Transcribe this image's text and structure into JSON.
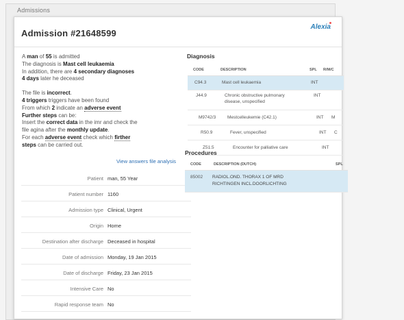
{
  "window": {
    "title": "Admissions"
  },
  "header": {
    "title": "Admission #21648599",
    "logo": "Alexia"
  },
  "summary": {
    "s1a": "A ",
    "s1b": "man",
    "s1c": " of ",
    "s1d": "55",
    "s1e": " is admitted",
    "s2a": "The diagnosis is ",
    "s2b": "Mast cell leukaemia",
    "s3a": "In addition, there are ",
    "s3b": "4 secondary diagnoses",
    "s4a": "4 days",
    "s4b": " later he deceased",
    "s5a": "The file is ",
    "s5b": "incorrect",
    "s5c": ".",
    "s6a": "4 triggers",
    "s6b": " triggers have been found",
    "s7a": "From which ",
    "s7b": "2",
    "s7c": " indicate an ",
    "s7d": "adverse event",
    "s8a": "Further steps",
    "s8b": " can be:",
    "s9a": "Insert the ",
    "s9b": "correct data",
    "s9c": " in the imr and check the",
    "s10a": "file agina after the ",
    "s10b": "monthly update",
    "s10c": ".",
    "s11a": "For each ",
    "s11b": "adverse event",
    "s11c": " check which ",
    "s11d": "firther",
    "s12a": "steps",
    "s12b": " can be carried out."
  },
  "view_link": "View answers file analysis",
  "details": [
    {
      "label": "Patient",
      "value": "man, 55 Year"
    },
    {
      "label": "Patient number",
      "value": "1160"
    },
    {
      "label": "Admission type",
      "value": "Clinical, Urgent"
    },
    {
      "label": "Origin",
      "value": "Home"
    },
    {
      "label": "Destination after discharge",
      "value": "Deceased in hospital"
    },
    {
      "label": "Date of admission",
      "value": "Monday, 19 Jan 2015"
    },
    {
      "label": "Date of discharge",
      "value": "Friday, 23 Jan 2015"
    },
    {
      "label": "Intensive Care",
      "value": "No"
    },
    {
      "label": "Rapid response team",
      "value": "No"
    }
  ],
  "diagnosis": {
    "title": "Diagnosis",
    "headers": {
      "code": "CODE",
      "description": "DESCRIPTION",
      "spl": "SPL",
      "rm": "R/M/C"
    },
    "rows": [
      {
        "code": "C94.3",
        "description": "Mast cell leukaemia",
        "spl": "INT",
        "rm": ""
      },
      {
        "code": "J44.9",
        "description": "Chronic obstructive pulmonary",
        "description2": "disease, unspecified",
        "spl": "INT",
        "rm": ""
      },
      {
        "code": "M9742/3",
        "description": "Mestcelleukemie (C42.1)",
        "spl": "INT",
        "rm": "M"
      },
      {
        "code": "R50.9",
        "description": "Fever, unspecified",
        "spl": "INT",
        "rm": "C"
      },
      {
        "code": "Z51.5",
        "description": "Encounter for palliative care",
        "spl": "INT",
        "rm": ""
      }
    ]
  },
  "procedures": {
    "title": "Procedures",
    "headers": {
      "code": "CODE",
      "description": "DESCRIPTION (DUTCH)",
      "spl": "SPL"
    },
    "rows": [
      {
        "code": "85002",
        "line1": "RADIOL.OND. THORAX 1 OF MRD",
        "line2": "RICHTINGEN INCL.DOORLICHTING"
      }
    ]
  },
  "colors": {
    "accent": "#2d6fb3",
    "highlight": "#d6e9f4"
  }
}
